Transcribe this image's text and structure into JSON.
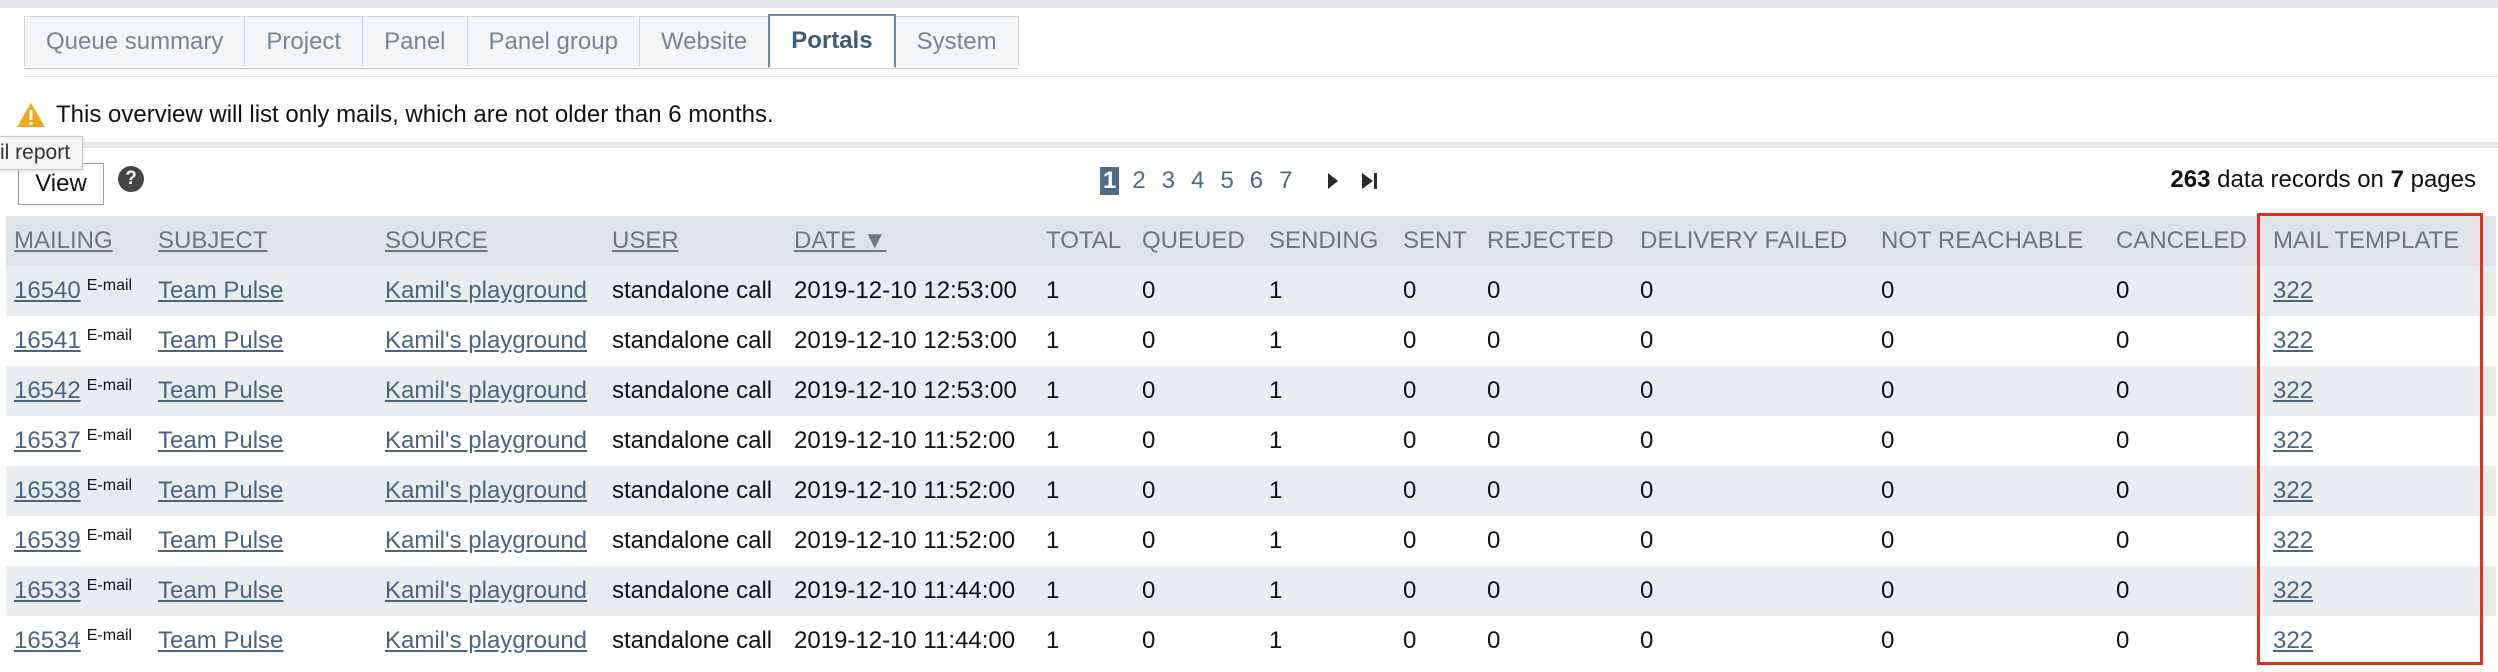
{
  "tabs": [
    {
      "label": "Queue summary",
      "active": false
    },
    {
      "label": "Project",
      "active": false
    },
    {
      "label": "Panel",
      "active": false
    },
    {
      "label": "Panel group",
      "active": false
    },
    {
      "label": "Website",
      "active": false
    },
    {
      "label": "Portals",
      "active": true
    },
    {
      "label": "System",
      "active": false
    }
  ],
  "notice": {
    "icon": "warning-icon",
    "text": "This overview will list only mails, which are not older than 6 months."
  },
  "toolbar": {
    "tooltip": "il report",
    "view_label": "View",
    "help_icon": "help-icon",
    "help_glyph": "?"
  },
  "pager": {
    "pages": [
      "1",
      "2",
      "3",
      "4",
      "5",
      "6",
      "7"
    ],
    "current": "1",
    "next_icon": "next-page-icon",
    "last_icon": "last-page-icon"
  },
  "records": {
    "count": "263",
    "mid": " data records on ",
    "pages": "7",
    "suffix": " pages"
  },
  "table": {
    "columns": [
      {
        "key": "mailing",
        "label": "MAILING",
        "sortable": true
      },
      {
        "key": "subject",
        "label": "SUBJECT",
        "sortable": true
      },
      {
        "key": "source",
        "label": "SOURCE",
        "sortable": true
      },
      {
        "key": "user",
        "label": "USER",
        "sortable": true
      },
      {
        "key": "date",
        "label": "DATE ▼",
        "sortable": true
      },
      {
        "key": "total",
        "label": "TOTAL",
        "sortable": false
      },
      {
        "key": "queued",
        "label": "QUEUED",
        "sortable": false
      },
      {
        "key": "sending",
        "label": "SENDING",
        "sortable": false
      },
      {
        "key": "sent",
        "label": "SENT",
        "sortable": false
      },
      {
        "key": "rejected",
        "label": "REJECTED",
        "sortable": false
      },
      {
        "key": "delivery_failed",
        "label": "DELIVERY FAILED",
        "sortable": false
      },
      {
        "key": "not_reachable",
        "label": "NOT REACHABLE",
        "sortable": false
      },
      {
        "key": "canceled",
        "label": "CANCELED",
        "sortable": false
      },
      {
        "key": "mail_template",
        "label": "MAIL TEMPLATE",
        "sortable": false
      }
    ],
    "rows": [
      {
        "mailing": "16540",
        "channel": "E-mail",
        "subject": "Team Pulse",
        "source": "Kamil's playground",
        "user": "standalone call",
        "date": "2019-12-10 12:53:00",
        "total": "1",
        "queued": "0",
        "sending": "1",
        "sent": "0",
        "rejected": "0",
        "delivery_failed": "0",
        "not_reachable": "0",
        "canceled": "0",
        "mail_template": "322"
      },
      {
        "mailing": "16541",
        "channel": "E-mail",
        "subject": "Team Pulse",
        "source": "Kamil's playground",
        "user": "standalone call",
        "date": "2019-12-10 12:53:00",
        "total": "1",
        "queued": "0",
        "sending": "1",
        "sent": "0",
        "rejected": "0",
        "delivery_failed": "0",
        "not_reachable": "0",
        "canceled": "0",
        "mail_template": "322"
      },
      {
        "mailing": "16542",
        "channel": "E-mail",
        "subject": "Team Pulse",
        "source": "Kamil's playground",
        "user": "standalone call",
        "date": "2019-12-10 12:53:00",
        "total": "1",
        "queued": "0",
        "sending": "1",
        "sent": "0",
        "rejected": "0",
        "delivery_failed": "0",
        "not_reachable": "0",
        "canceled": "0",
        "mail_template": "322"
      },
      {
        "mailing": "16537",
        "channel": "E-mail",
        "subject": "Team Pulse",
        "source": "Kamil's playground",
        "user": "standalone call",
        "date": "2019-12-10 11:52:00",
        "total": "1",
        "queued": "0",
        "sending": "1",
        "sent": "0",
        "rejected": "0",
        "delivery_failed": "0",
        "not_reachable": "0",
        "canceled": "0",
        "mail_template": "322"
      },
      {
        "mailing": "16538",
        "channel": "E-mail",
        "subject": "Team Pulse",
        "source": "Kamil's playground",
        "user": "standalone call",
        "date": "2019-12-10 11:52:00",
        "total": "1",
        "queued": "0",
        "sending": "1",
        "sent": "0",
        "rejected": "0",
        "delivery_failed": "0",
        "not_reachable": "0",
        "canceled": "0",
        "mail_template": "322"
      },
      {
        "mailing": "16539",
        "channel": "E-mail",
        "subject": "Team Pulse",
        "source": "Kamil's playground",
        "user": "standalone call",
        "date": "2019-12-10 11:52:00",
        "total": "1",
        "queued": "0",
        "sending": "1",
        "sent": "0",
        "rejected": "0",
        "delivery_failed": "0",
        "not_reachable": "0",
        "canceled": "0",
        "mail_template": "322"
      },
      {
        "mailing": "16533",
        "channel": "E-mail",
        "subject": "Team Pulse",
        "source": "Kamil's playground",
        "user": "standalone call",
        "date": "2019-12-10 11:44:00",
        "total": "1",
        "queued": "0",
        "sending": "1",
        "sent": "0",
        "rejected": "0",
        "delivery_failed": "0",
        "not_reachable": "0",
        "canceled": "0",
        "mail_template": "322"
      },
      {
        "mailing": "16534",
        "channel": "E-mail",
        "subject": "Team Pulse",
        "source": "Kamil's playground",
        "user": "standalone call",
        "date": "2019-12-10 11:44:00",
        "total": "1",
        "queued": "0",
        "sending": "1",
        "sent": "0",
        "rejected": "0",
        "delivery_failed": "0",
        "not_reachable": "0",
        "canceled": "0",
        "mail_template": "322"
      }
    ]
  },
  "highlight": {
    "column": "mail_template",
    "color": "#e0321e"
  }
}
